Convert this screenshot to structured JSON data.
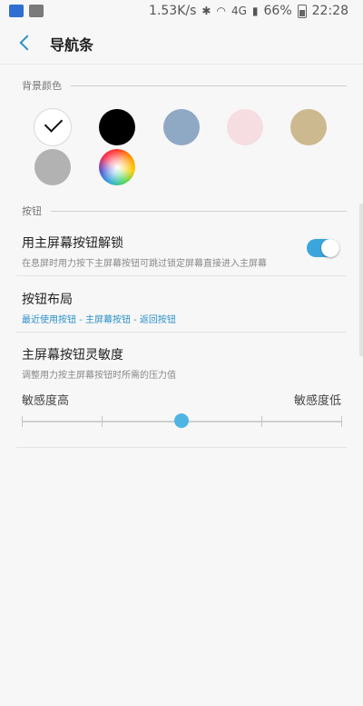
{
  "status_bar": {
    "speed": "1.53K/s",
    "network": "4G",
    "battery": "66%",
    "time": "22:28"
  },
  "app_bar": {
    "title": "导航条"
  },
  "background_section": {
    "header": "背景颜色",
    "swatches": [
      {
        "name": "white",
        "color": "#ffffff",
        "selected": true
      },
      {
        "name": "black",
        "color": "#000000"
      },
      {
        "name": "blue-gray",
        "color": "#8fa8c4"
      },
      {
        "name": "pink",
        "color": "#f5dde1"
      },
      {
        "name": "tan",
        "color": "#cdb98f"
      },
      {
        "name": "gray",
        "color": "#b2b2b2"
      },
      {
        "name": "custom-rainbow",
        "color": "rainbow"
      }
    ]
  },
  "buttons_section": {
    "header": "按钮",
    "unlock": {
      "title": "用主屏幕按钮解锁",
      "subtitle": "在息屏时用力按下主屏幕按钮可跳过锁定屏幕直接进入主屏幕",
      "enabled": true
    },
    "layout": {
      "title": "按钮布局",
      "subtitle": "最近使用按钮 - 主屏幕按钮 - 返回按钮"
    },
    "sensitivity": {
      "title": "主屏幕按钮灵敏度",
      "subtitle": "调整用力按主屏幕按钮时所需的压力值",
      "label_high": "敏感度高",
      "label_low": "敏感度低",
      "steps": 5,
      "value_index": 2
    }
  },
  "colors": {
    "accent": "#2a8fc7",
    "toggle_on": "#3aa6dd",
    "slider_thumb": "#4eb5e3"
  }
}
